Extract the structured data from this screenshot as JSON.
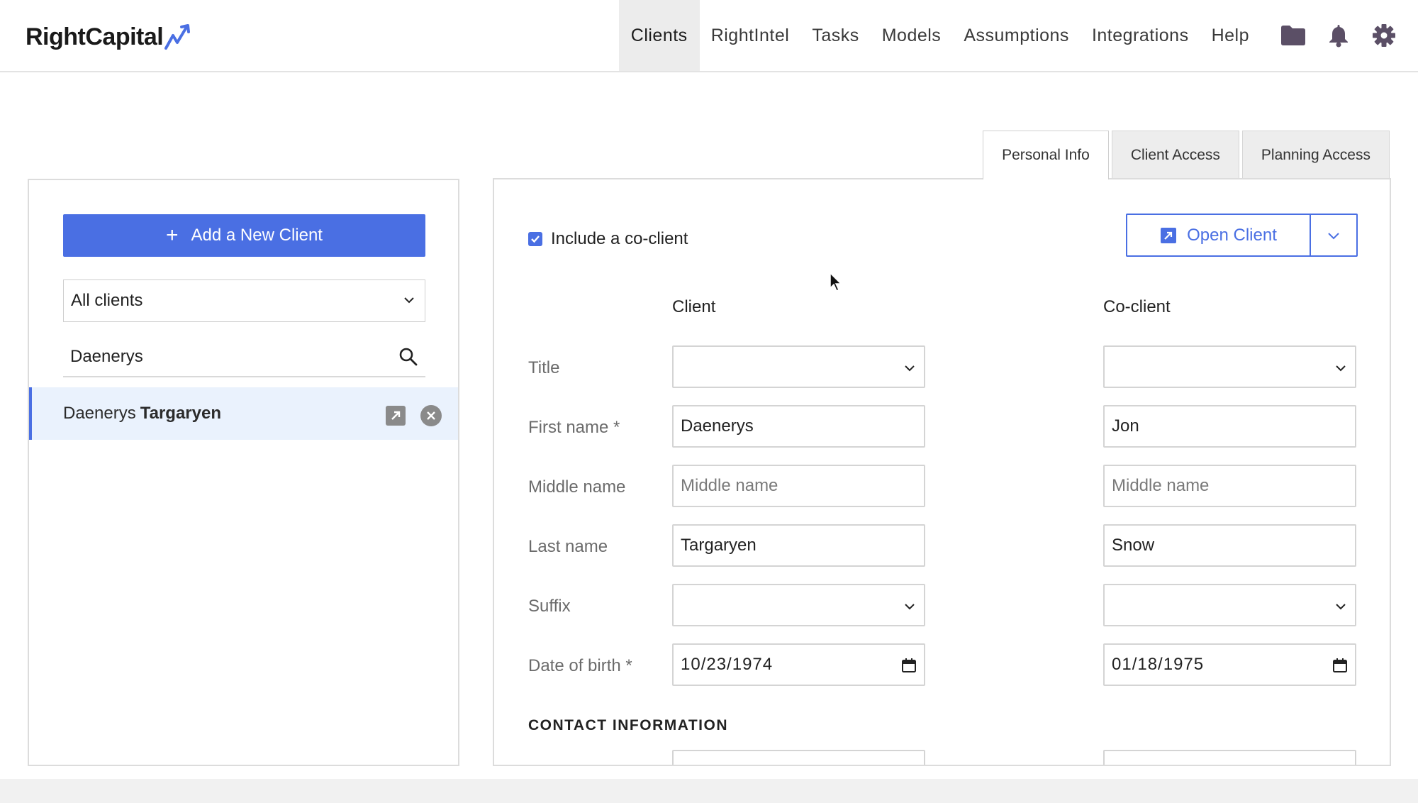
{
  "brand": {
    "name": "RightCapital",
    "accent": "#4a6fe3"
  },
  "nav": {
    "items": [
      {
        "label": "Clients",
        "active": true
      },
      {
        "label": "RightIntel"
      },
      {
        "label": "Tasks"
      },
      {
        "label": "Models"
      },
      {
        "label": "Assumptions"
      },
      {
        "label": "Integrations"
      },
      {
        "label": "Help"
      }
    ],
    "icons": [
      "folder-icon",
      "bell-icon",
      "gear-icon"
    ]
  },
  "tabs": [
    {
      "label": "Personal Info",
      "active": true
    },
    {
      "label": "Client Access"
    },
    {
      "label": "Planning Access"
    }
  ],
  "sidebar": {
    "add_button": "Add a New Client",
    "filter_value": "All clients",
    "search_value": "Daenerys",
    "client": {
      "first": "Daenerys",
      "last": "Targaryen"
    }
  },
  "form": {
    "coclient_label": "Include a co-client",
    "coclient_checked": true,
    "open_client": "Open Client",
    "col_client": "Client",
    "col_coclient": "Co-client",
    "labels": {
      "title": "Title",
      "first_name": "First name *",
      "middle_name": "Middle name",
      "last_name": "Last name",
      "suffix": "Suffix",
      "dob": "Date of birth *"
    },
    "client": {
      "title": "",
      "first_name": "Daenerys",
      "middle_placeholder": "Middle name",
      "last_name": "Targaryen",
      "suffix": "",
      "dob": "10/23/1974"
    },
    "coclient": {
      "title": "",
      "first_name": "Jon",
      "middle_placeholder": "Middle name",
      "last_name": "Snow",
      "suffix": "",
      "dob": "01/18/1975"
    },
    "contact_section": "CONTACT INFORMATION"
  }
}
